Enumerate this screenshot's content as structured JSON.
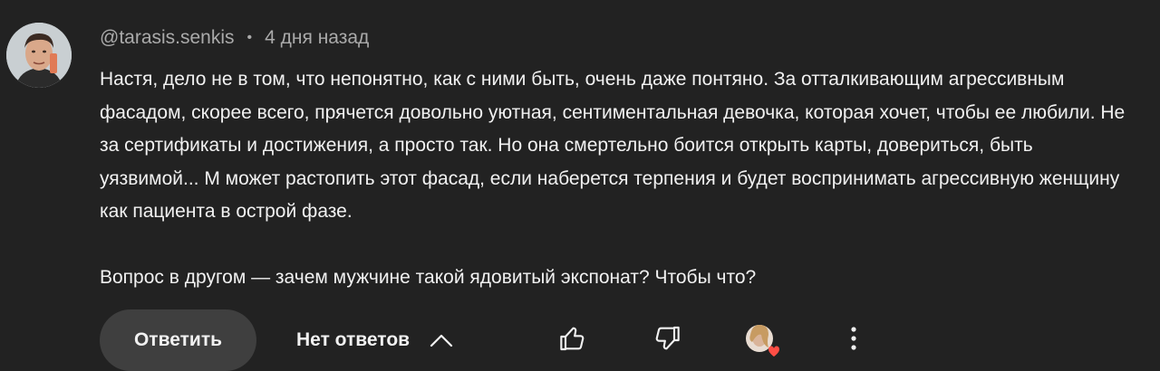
{
  "comment": {
    "author": "@tarasis.senkis",
    "separator": "•",
    "timestamp": "4 дня назад",
    "paragraphs": [
      "Настя, дело не в том, что непонятно, как с ними быть, очень даже понтяно. За отталкивающим агрессивным фасадом, скорее всего, прячется довольно уютная, сентиментальная девочка, которая хочет, чтобы ее любили. Не за сертификаты и достижения, а просто так. Но она смертельно боится открыть карты, довериться, быть уязвимой... М может растопить этот фасад, если наберется терпения и будет воспринимать агрессивную женщину как пациента в острой фазе.",
      "Вопрос в другом — зачем мужчине такой ядовитый экспонат? Чтобы что?"
    ]
  },
  "actions": {
    "reply_label": "Ответить",
    "replies_label": "Нет ответов"
  },
  "icons": {
    "like": "thumbs-up-icon",
    "dislike": "thumbs-down-icon",
    "heart": "creator-heart-icon",
    "more": "more-vertical-icon",
    "chevron": "chevron-up-icon"
  },
  "colors": {
    "background": "#222222",
    "text": "#f1f1f1",
    "muted": "#aaaaaa",
    "button": "#3f3f3f",
    "heart": "#ff4e45"
  }
}
